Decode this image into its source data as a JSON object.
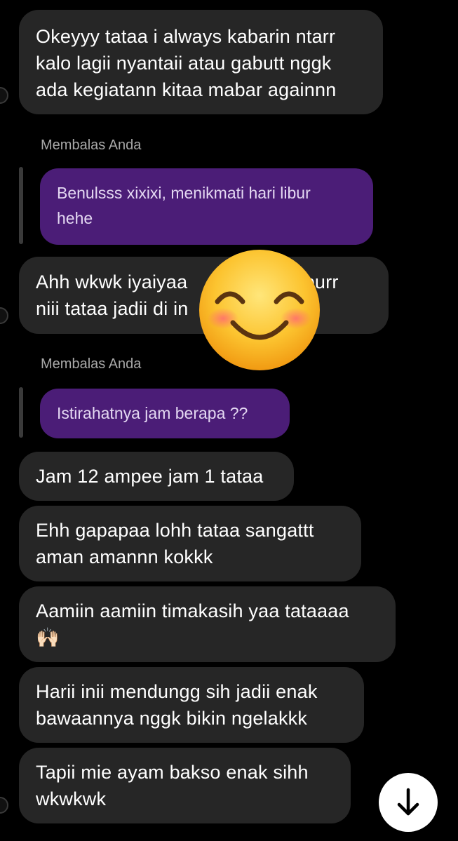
{
  "messages": [
    {
      "id": "m1",
      "text": "Okeyyy tataa i always kabarin ntarr\nkalo lagii nyantaii atau gabutt nggk\nada kegiatann kitaa mabar againnn"
    },
    {
      "id": "r1",
      "reply_label": "Membalas Anda",
      "quoted": "Benulsss xixixi, menikmati hari libur\nhehe"
    },
    {
      "id": "m2",
      "text": "Ahh wkwk iyaiyaa                    liburr\nniii tataa jadii di in                    r"
    },
    {
      "id": "r2",
      "reply_label": "Membalas Anda",
      "quoted": "Istirahatnya jam berapa ??"
    },
    {
      "id": "m3",
      "text": "Jam 12 ampee jam 1 tataa"
    },
    {
      "id": "m4",
      "text": "Ehh gapapaa lohh tataa sangattt\naman amannn kokkk"
    },
    {
      "id": "m5",
      "text": "Aamiin aamiin timakasih yaa tataaaa\n🙌🏻"
    },
    {
      "id": "m6",
      "text": "Harii inii mendungg sih jadii enak\nbawaannya nggk bikin ngelakkk"
    },
    {
      "id": "m7",
      "text": "Tapii mie ayam bakso enak sihh\nwkwkwk"
    }
  ],
  "overlay_emoji": "smiling-face-with-smiling-eyes",
  "colors": {
    "background": "#000000",
    "received_bubble": "#262626",
    "quoted_bubble": "#4b1d77",
    "reply_label": "#a8a8a8"
  },
  "scroll_button": {
    "icon": "arrow-down-icon"
  }
}
